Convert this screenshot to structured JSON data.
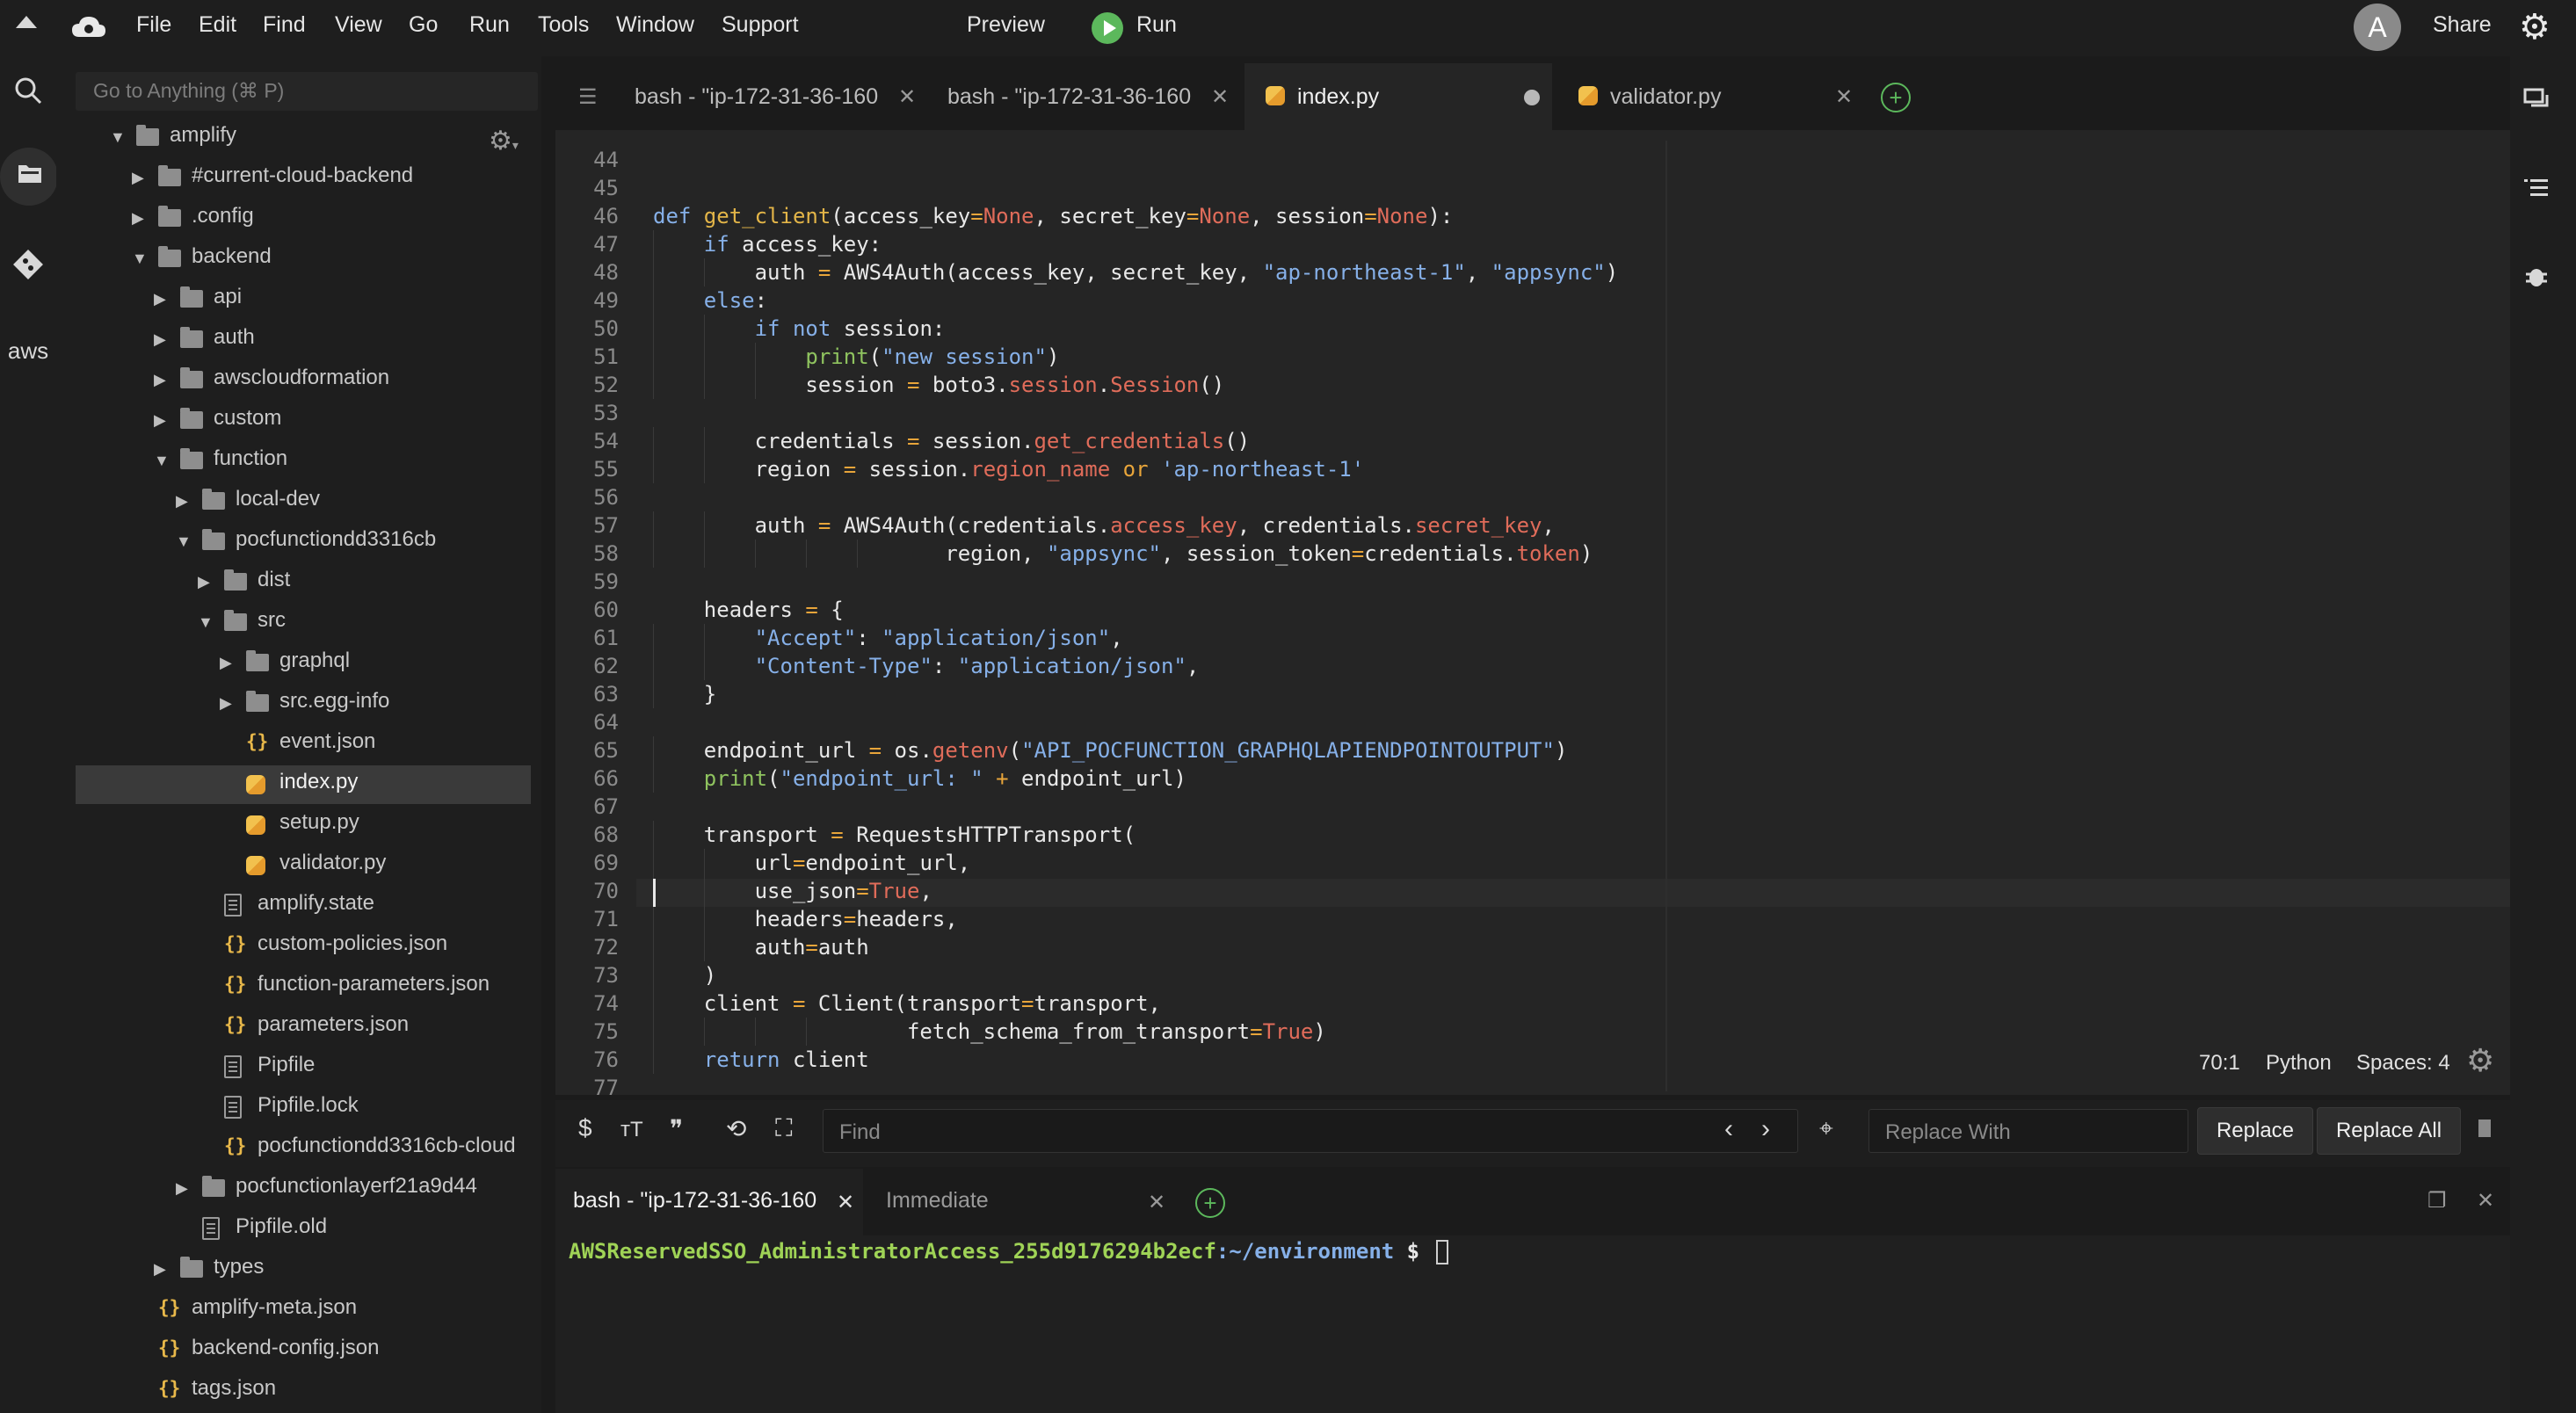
{
  "menubar": {
    "items": [
      "File",
      "Edit",
      "Find",
      "View",
      "Go",
      "Run",
      "Tools",
      "Window",
      "Support"
    ],
    "preview": "Preview",
    "run": "Run",
    "avatar_letter": "A",
    "share": "Share"
  },
  "sidebar": {
    "goto_placeholder": "Go to Anything (⌘ P)",
    "tree": [
      {
        "label": "amplify",
        "kind": "folder",
        "expanded": true
      },
      {
        "label": "#current-cloud-backend",
        "kind": "folder",
        "expanded": false
      },
      {
        "label": ".config",
        "kind": "folder",
        "expanded": false
      },
      {
        "label": "backend",
        "kind": "folder",
        "expanded": true
      },
      {
        "label": "api",
        "kind": "folder",
        "expanded": false
      },
      {
        "label": "auth",
        "kind": "folder",
        "expanded": false
      },
      {
        "label": "awscloudformation",
        "kind": "folder",
        "expanded": false
      },
      {
        "label": "custom",
        "kind": "folder",
        "expanded": false
      },
      {
        "label": "function",
        "kind": "folder",
        "expanded": true
      },
      {
        "label": "local-dev",
        "kind": "folder",
        "expanded": false
      },
      {
        "label": "pocfunctiondd3316cb",
        "kind": "folder",
        "expanded": true
      },
      {
        "label": "dist",
        "kind": "folder",
        "expanded": false
      },
      {
        "label": "src",
        "kind": "folder",
        "expanded": true
      },
      {
        "label": "graphql",
        "kind": "folder",
        "expanded": false
      },
      {
        "label": "src.egg-info",
        "kind": "folder",
        "expanded": false
      },
      {
        "label": "event.json",
        "kind": "json"
      },
      {
        "label": "index.py",
        "kind": "py"
      },
      {
        "label": "setup.py",
        "kind": "py"
      },
      {
        "label": "validator.py",
        "kind": "py"
      },
      {
        "label": "amplify.state",
        "kind": "doc"
      },
      {
        "label": "custom-policies.json",
        "kind": "json"
      },
      {
        "label": "function-parameters.json",
        "kind": "json"
      },
      {
        "label": "parameters.json",
        "kind": "json"
      },
      {
        "label": "Pipfile",
        "kind": "doc"
      },
      {
        "label": "Pipfile.lock",
        "kind": "doc"
      },
      {
        "label": "pocfunctiondd3316cb-cloud",
        "kind": "json"
      },
      {
        "label": "pocfunctionlayerf21a9d44",
        "kind": "folder",
        "expanded": false
      },
      {
        "label": "Pipfile.old",
        "kind": "doc"
      },
      {
        "label": "types",
        "kind": "folder",
        "expanded": false
      },
      {
        "label": "amplify-meta.json",
        "kind": "json"
      },
      {
        "label": "backend-config.json",
        "kind": "json"
      },
      {
        "label": "tags.json",
        "kind": "json"
      }
    ]
  },
  "editor": {
    "tabs": [
      {
        "label": "bash - \"ip-172-31-36-160",
        "active": false
      },
      {
        "label": "bash - \"ip-172-31-36-160",
        "active": false
      },
      {
        "label": "index.py",
        "active": true,
        "modified": true
      },
      {
        "label": "validator.py",
        "active": false
      }
    ],
    "first_line": 44,
    "lines": [
      [],
      [],
      [
        [
          "kw",
          "def "
        ],
        [
          "fn",
          "get_client"
        ],
        [
          "pl",
          "(access_key"
        ],
        [
          "op",
          "="
        ],
        [
          "attr",
          "None"
        ],
        [
          "pl",
          ", secret_key"
        ],
        [
          "op",
          "="
        ],
        [
          "attr",
          "None"
        ],
        [
          "pl",
          ", session"
        ],
        [
          "op",
          "="
        ],
        [
          "attr",
          "None"
        ],
        [
          "pl",
          "):"
        ]
      ],
      [
        [
          "pl",
          "    "
        ],
        [
          "kw",
          "if "
        ],
        [
          "pl",
          "access_key:"
        ]
      ],
      [
        [
          "pl",
          "        auth "
        ],
        [
          "op",
          "= "
        ],
        [
          "pl",
          "AWS4Auth(access_key, secret_key, "
        ],
        [
          "str",
          "\"ap-northeast-1\""
        ],
        [
          "pl",
          ", "
        ],
        [
          "str",
          "\"appsync\""
        ],
        [
          "pl",
          ")"
        ]
      ],
      [
        [
          "pl",
          "    "
        ],
        [
          "kw",
          "else"
        ],
        [
          "pl",
          ":"
        ]
      ],
      [
        [
          "pl",
          "        "
        ],
        [
          "kw",
          "if not "
        ],
        [
          "pl",
          "session:"
        ]
      ],
      [
        [
          "pl",
          "            "
        ],
        [
          "bi",
          "print"
        ],
        [
          "pl",
          "("
        ],
        [
          "str",
          "\"new session\""
        ],
        [
          "pl",
          ")"
        ]
      ],
      [
        [
          "pl",
          "            session "
        ],
        [
          "op",
          "= "
        ],
        [
          "pl",
          "boto3."
        ],
        [
          "attr",
          "session"
        ],
        [
          "pl",
          "."
        ],
        [
          "attr",
          "Session"
        ],
        [
          "pl",
          "()"
        ]
      ],
      [],
      [
        [
          "pl",
          "        credentials "
        ],
        [
          "op",
          "= "
        ],
        [
          "pl",
          "session."
        ],
        [
          "attr",
          "get_credentials"
        ],
        [
          "pl",
          "()"
        ]
      ],
      [
        [
          "pl",
          "        region "
        ],
        [
          "op",
          "= "
        ],
        [
          "pl",
          "session."
        ],
        [
          "attr",
          "region_name "
        ],
        [
          "op",
          "or "
        ],
        [
          "str",
          "'ap-northeast-1'"
        ]
      ],
      [],
      [
        [
          "pl",
          "        auth "
        ],
        [
          "op",
          "= "
        ],
        [
          "pl",
          "AWS4Auth(credentials."
        ],
        [
          "attr",
          "access_key"
        ],
        [
          "pl",
          ", credentials."
        ],
        [
          "attr",
          "secret_key"
        ],
        [
          "pl",
          ","
        ]
      ],
      [
        [
          "pl",
          "                       region, "
        ],
        [
          "str",
          "\"appsync\""
        ],
        [
          "pl",
          ", session_token"
        ],
        [
          "op",
          "="
        ],
        [
          "pl",
          "credentials."
        ],
        [
          "attr",
          "token"
        ],
        [
          "pl",
          ")"
        ]
      ],
      [],
      [
        [
          "pl",
          "    headers "
        ],
        [
          "op",
          "= "
        ],
        [
          "pl",
          "{"
        ]
      ],
      [
        [
          "pl",
          "        "
        ],
        [
          "str",
          "\"Accept\""
        ],
        [
          "pl",
          ": "
        ],
        [
          "str",
          "\"application/json\""
        ],
        [
          "pl",
          ","
        ]
      ],
      [
        [
          "pl",
          "        "
        ],
        [
          "str",
          "\"Content-Type\""
        ],
        [
          "pl",
          ": "
        ],
        [
          "str",
          "\"application/json\""
        ],
        [
          "pl",
          ","
        ]
      ],
      [
        [
          "pl",
          "    }"
        ]
      ],
      [],
      [
        [
          "pl",
          "    endpoint_url "
        ],
        [
          "op",
          "= "
        ],
        [
          "pl",
          "os."
        ],
        [
          "attr",
          "getenv"
        ],
        [
          "pl",
          "("
        ],
        [
          "str",
          "\"API_POCFUNCTION_GRAPHQLAPIENDPOINTOUTPUT\""
        ],
        [
          "pl",
          ")"
        ]
      ],
      [
        [
          "pl",
          "    "
        ],
        [
          "bi",
          "print"
        ],
        [
          "pl",
          "("
        ],
        [
          "str",
          "\"endpoint_url: \" "
        ],
        [
          "op",
          "+ "
        ],
        [
          "pl",
          "endpoint_url)"
        ]
      ],
      [],
      [
        [
          "pl",
          "    transport "
        ],
        [
          "op",
          "= "
        ],
        [
          "pl",
          "RequestsHTTPTransport("
        ]
      ],
      [
        [
          "pl",
          "        url"
        ],
        [
          "op",
          "="
        ],
        [
          "pl",
          "endpoint_url,"
        ]
      ],
      [
        [
          "pl",
          "        use_json"
        ],
        [
          "op",
          "="
        ],
        [
          "attr",
          "True"
        ],
        [
          "pl",
          ","
        ]
      ],
      [
        [
          "pl",
          "        headers"
        ],
        [
          "op",
          "="
        ],
        [
          "pl",
          "headers,"
        ]
      ],
      [
        [
          "pl",
          "        auth"
        ],
        [
          "op",
          "="
        ],
        [
          "pl",
          "auth"
        ]
      ],
      [
        [
          "pl",
          "    )"
        ]
      ],
      [
        [
          "pl",
          "    client "
        ],
        [
          "op",
          "= "
        ],
        [
          "pl",
          "Client(transport"
        ],
        [
          "op",
          "="
        ],
        [
          "pl",
          "transport,"
        ]
      ],
      [
        [
          "pl",
          "                    fetch_schema_from_transport"
        ],
        [
          "op",
          "="
        ],
        [
          "attr",
          "True"
        ],
        [
          "pl",
          ")"
        ]
      ],
      [
        [
          "pl",
          "    "
        ],
        [
          "kw",
          "return "
        ],
        [
          "pl",
          "client"
        ]
      ],
      []
    ],
    "status": {
      "position": "70:1",
      "language": "Python",
      "indent": "Spaces: 4"
    }
  },
  "findbar": {
    "find_placeholder": "Find",
    "replace_placeholder": "Replace With",
    "replace_label": "Replace",
    "replace_all_label": "Replace All"
  },
  "terminal": {
    "tabs": [
      {
        "label": "bash - \"ip-172-31-36-160",
        "active": true
      },
      {
        "label": "Immediate",
        "active": false
      }
    ],
    "prompt_user": "AWSReservedSSO_AdministratorAccess_255d9176294b2ecf",
    "prompt_path": ":~/environment",
    "prompt_symbol": " $ "
  },
  "colors": {
    "accent_run": "#5cb85c",
    "keyword": "#86b0e8",
    "function": "#e3b548",
    "attribute": "#e06c5a",
    "terminal_user": "#9fd356"
  }
}
